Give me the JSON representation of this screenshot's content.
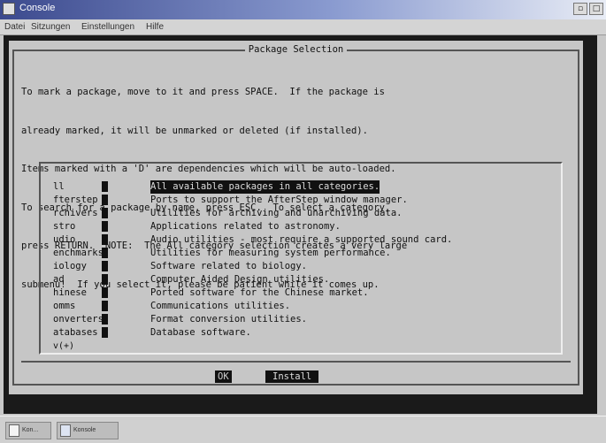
{
  "window": {
    "title": "Console",
    "buttons": [
      "▫",
      "□"
    ]
  },
  "menubar": {
    "items": [
      "Datei",
      "Sitzungen",
      "Einstellungen",
      "Hilfe"
    ]
  },
  "dialog": {
    "title": "Package Selection",
    "instructions": [
      "To mark a package, move to it and press SPACE.  If the package is",
      "already marked, it will be unmarked or deleted (if installed).",
      "Items marked with a 'D' are dependencies which will be auto-loaded.",
      "To search for a package by name, press ESC.  To select a category,",
      "press RETURN.  NOTE:  The All category selection creates a very large",
      "submenu!  If you select it, please be patient while it comes up."
    ],
    "list": {
      "more_top": "",
      "items": [
        {
          "tag": "ll",
          "desc": "All available packages in all categories.",
          "selected": true
        },
        {
          "tag": "fterstep",
          "desc": "Ports to support the AfterStep window manager."
        },
        {
          "tag": "rchivers",
          "desc": "Utilities for archiving and unarchiving data."
        },
        {
          "tag": "stro",
          "desc": "Applications related to astronomy."
        },
        {
          "tag": "udio",
          "desc": "Audio utilities - most require a supported sound card."
        },
        {
          "tag": "enchmarks",
          "desc": "Utilities for measuring system performance."
        },
        {
          "tag": "iology",
          "desc": "Software related to biology."
        },
        {
          "tag": "ad",
          "desc": "Computer Aided Design utilities."
        },
        {
          "tag": "hinese",
          "desc": "Ported software for the Chinese market."
        },
        {
          "tag": "omms",
          "desc": "Communications utilities."
        },
        {
          "tag": "onverters",
          "desc": "Format conversion utilities."
        },
        {
          "tag": "atabases",
          "desc": "Database software."
        }
      ],
      "more_bottom": "v(+)"
    },
    "buttons": {
      "ok": "OK",
      "install": "Install"
    }
  },
  "taskbar": {
    "items": [
      {
        "label": "Kon..."
      },
      {
        "label": "Konsole"
      }
    ]
  }
}
